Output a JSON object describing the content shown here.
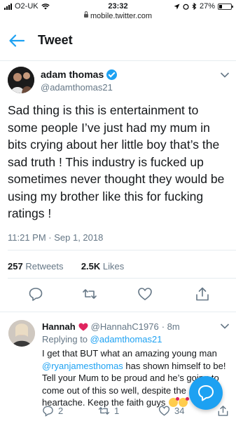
{
  "status_bar": {
    "carrier": "O2-UK",
    "time": "23:32",
    "url": "mobile.twitter.com",
    "battery": "27%",
    "battery_level": 0.27
  },
  "header": {
    "title": "Tweet"
  },
  "tweet": {
    "name": "adam thomas",
    "handle": "@adamthomas21",
    "text": "Sad thing is this is entertainment to some people I’ve just had my mum in bits crying about her little boy that’s the sad truth ! This industry is fucked up sometimes never thought they would be using my brother like this for fucking ratings !",
    "timestamp": "11:21 PM · Sep 1, 2018",
    "retweets_count": "257",
    "retweets_label": "Retweets",
    "likes_count": "2.5K",
    "likes_label": "Likes"
  },
  "reply": {
    "name": "Hannah",
    "handle": "@HannahC1976",
    "age": "· 8m",
    "replying_prefix": "Replying to",
    "replying_to": "@adamthomas21",
    "text_before": "I get that BUT what an amazing young man",
    "mention": "@ryanjamesthomas",
    "text_after": "has shown himself to be! Tell your Mum to be proud and he’s going to come out of this so well, despite the heartache. Keep the faith guys",
    "reply_count": "2",
    "retweet_count": "1",
    "like_count": "34"
  },
  "colors": {
    "accent": "#1da1f2",
    "text": "#14171a",
    "secondary": "#657786",
    "border": "#e6ecf0"
  }
}
